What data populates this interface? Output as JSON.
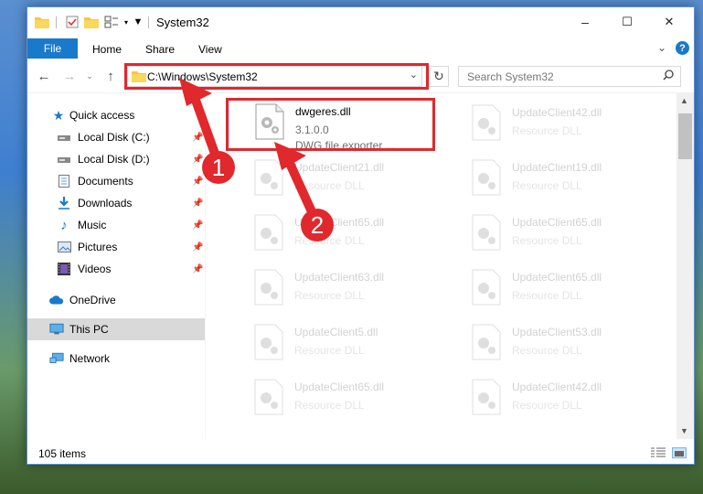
{
  "window": {
    "title": "System32",
    "controls": {
      "minimize": "–",
      "maximize": "☐",
      "close": "✕"
    }
  },
  "ribbon": {
    "file_tab": "File",
    "tabs": [
      "Home",
      "Share",
      "View"
    ],
    "help": "?"
  },
  "nav": {
    "address": "C:\\Windows\\System32",
    "search_placeholder": "Search System32"
  },
  "sidebar": {
    "items": [
      {
        "label": "Quick access",
        "icon": "star-icon"
      },
      {
        "label": "Local Disk (C:)",
        "icon": "drive-icon",
        "pinned": true
      },
      {
        "label": "Local Disk (D:)",
        "icon": "drive-icon",
        "pinned": true
      },
      {
        "label": "Documents",
        "icon": "documents-icon",
        "pinned": true
      },
      {
        "label": "Downloads",
        "icon": "download-icon",
        "pinned": true
      },
      {
        "label": "Music",
        "icon": "music-icon",
        "pinned": true
      },
      {
        "label": "Pictures",
        "icon": "pictures-icon",
        "pinned": true
      },
      {
        "label": "Videos",
        "icon": "videos-icon",
        "pinned": true
      },
      {
        "label": "OneDrive",
        "icon": "cloud-icon"
      },
      {
        "label": "This PC",
        "icon": "computer-icon",
        "selected": true
      },
      {
        "label": "Network",
        "icon": "network-icon"
      }
    ]
  },
  "files": {
    "highlighted": {
      "name": "dwgeres.dll",
      "version": "3.1.0.0",
      "description": "DWG file exporter ..."
    },
    "left_column": [
      {
        "name": "UpdateClient21.dll",
        "type": "Resource DLL"
      },
      {
        "name": "UpdateClient65.dll",
        "type": "Resource DLL"
      },
      {
        "name": "UpdateClient63.dll",
        "type": "Resource DLL"
      },
      {
        "name": "UpdateClient5.dll",
        "type": "Resource DLL"
      },
      {
        "name": "UpdateClient65.dll",
        "type": "Resource DLL"
      }
    ],
    "right_column": [
      {
        "name": "UpdateClient42.dll",
        "type": "Resource DLL"
      },
      {
        "name": "UpdateClient19.dll",
        "type": "Resource DLL"
      },
      {
        "name": "UpdateClient65.dll",
        "type": "Resource DLL"
      },
      {
        "name": "UpdateClient65.dll",
        "type": "Resource DLL"
      },
      {
        "name": "UpdateClient53.dll",
        "type": "Resource DLL"
      },
      {
        "name": "UpdateClient42.dll",
        "type": "Resource DLL"
      }
    ]
  },
  "status": {
    "item_count": "105 items"
  },
  "annotations": {
    "step1": "1",
    "step2": "2"
  },
  "colors": {
    "accent": "#1979ca",
    "highlight": "#e0282d",
    "selected": "#d9d9d9"
  }
}
